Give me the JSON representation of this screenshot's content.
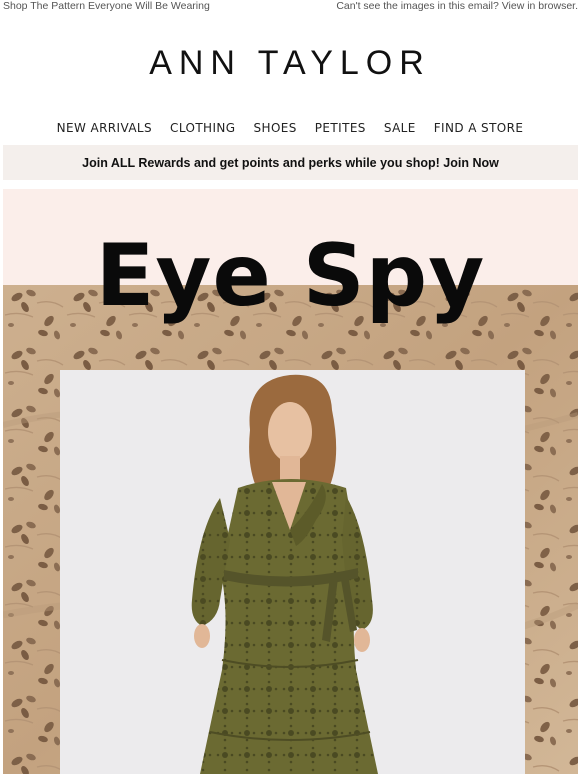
{
  "preheader": {
    "left_text": "Shop The Pattern Everyone Will Be Wearing",
    "right_text": "Can't see the images in this email? View in browser."
  },
  "brand": {
    "logo": "ANN TAYLOR"
  },
  "nav": {
    "items": [
      "NEW ARRIVALS",
      "CLOTHING",
      "SHOES",
      "PETITES",
      "SALE",
      "FIND A STORE"
    ]
  },
  "rewards_banner": {
    "text": "Join ALL Rewards and get points and perks while you shop! Join Now"
  },
  "hero": {
    "title": "Eye Spy",
    "colors": {
      "top_band": "#fbeeea",
      "fabric": "#c9a987",
      "dress": "#6b6a32",
      "photo_bg": "#ecebed"
    }
  }
}
